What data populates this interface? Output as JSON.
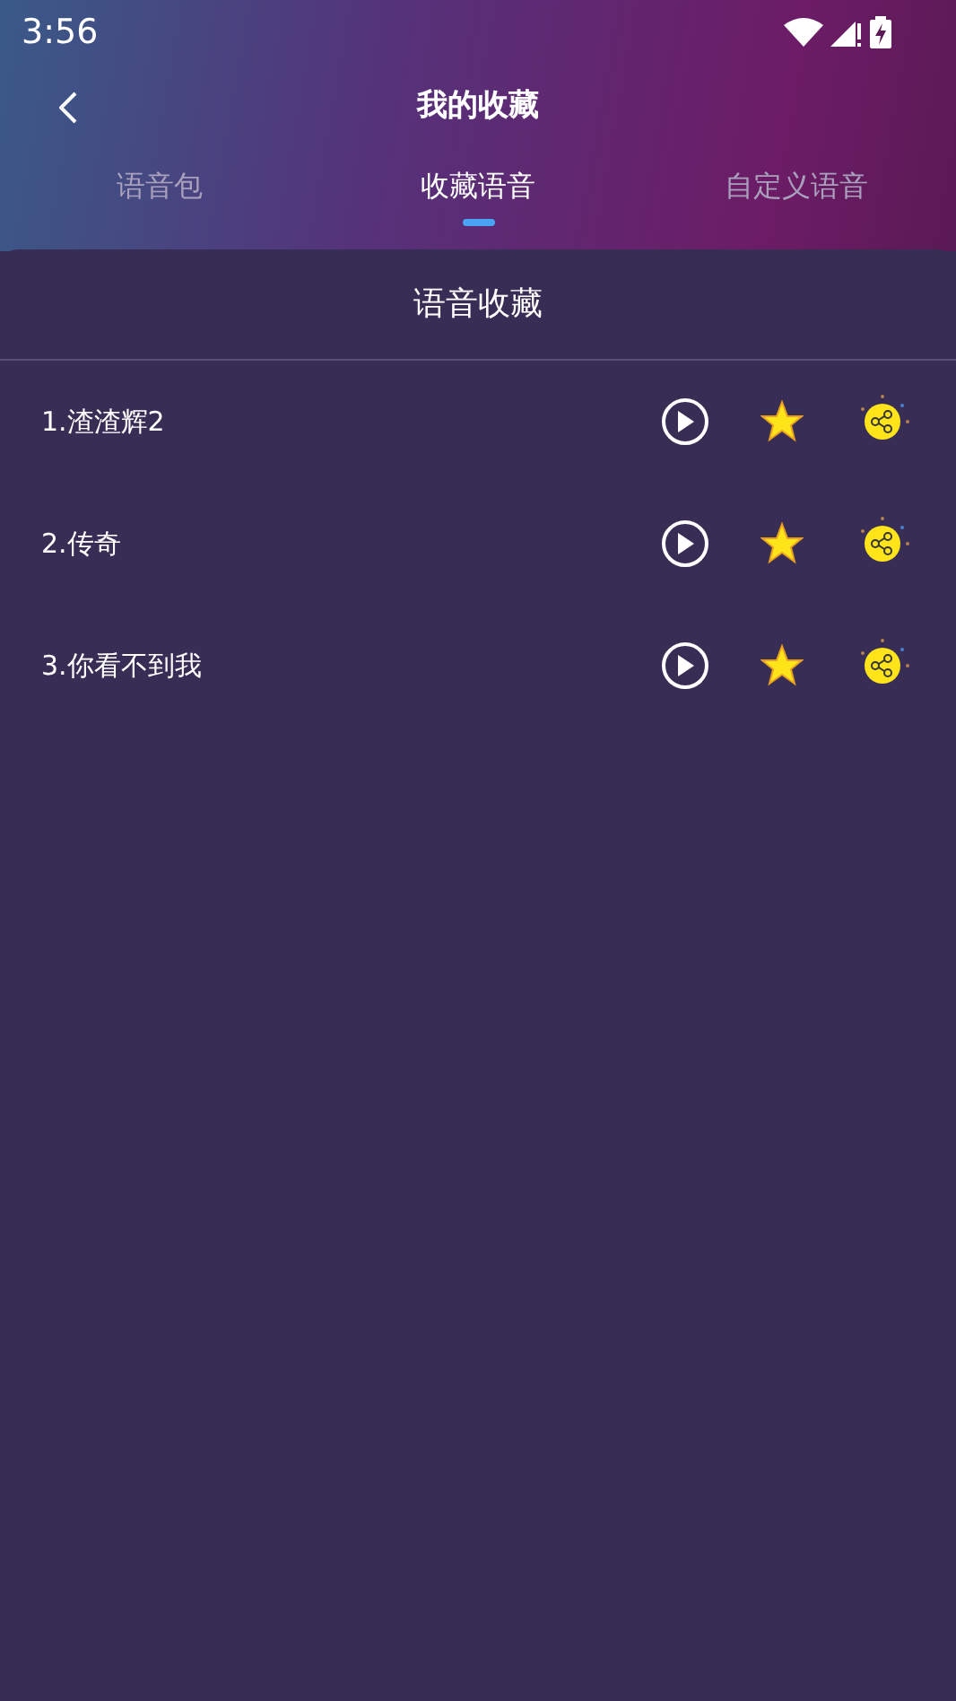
{
  "status_bar": {
    "time": "3:56"
  },
  "header": {
    "title": "我的收藏"
  },
  "tabs": [
    {
      "label": "语音包",
      "selected": false
    },
    {
      "label": "收藏语音",
      "selected": true
    },
    {
      "label": "自定义语音",
      "selected": false
    }
  ],
  "panel": {
    "title": "语音收藏",
    "items": [
      {
        "label": "1.渣渣辉2",
        "starred": true
      },
      {
        "label": "2.传奇",
        "starred": true
      },
      {
        "label": "3.你看不到我",
        "starred": true
      }
    ]
  }
}
